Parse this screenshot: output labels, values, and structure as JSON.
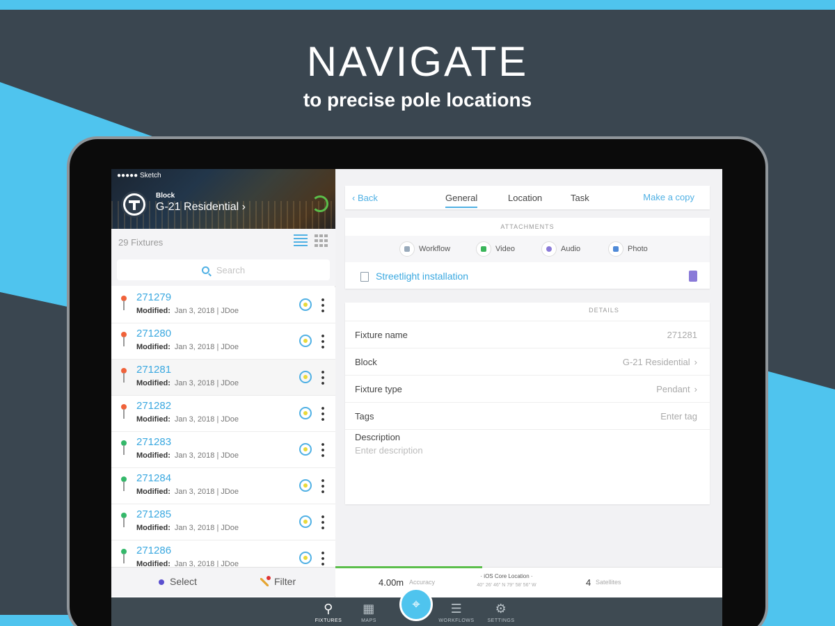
{
  "hero": {
    "title": "NAVIGATE",
    "subtitle": "to precise pole locations"
  },
  "colors": {
    "accent": "#4fb0e4",
    "background": "#3a4650",
    "stripe": "#4fc4ee",
    "pin_orange": "#f0623a",
    "pin_green": "#34b86a"
  },
  "statusbar": {
    "carrier": "●●●●● Sketch"
  },
  "header": {
    "block_label": "Block",
    "block_name": "G-21 Residential ›",
    "sync_icon": "sync-icon"
  },
  "fixtures": {
    "count_label": "29 Fixtures",
    "search_placeholder": "Search"
  },
  "list": [
    {
      "id": "271279",
      "modified_label": "Modified:",
      "modified": "Jan 3, 2018 | JDoe",
      "pin": "orange"
    },
    {
      "id": "271280",
      "modified_label": "Modified:",
      "modified": "Jan 3, 2018 | JDoe",
      "pin": "orange"
    },
    {
      "id": "271281",
      "modified_label": "Modified:",
      "modified": "Jan 3, 2018 | JDoe",
      "pin": "orange"
    },
    {
      "id": "271282",
      "modified_label": "Modified:",
      "modified": "Jan 3, 2018 | JDoe",
      "pin": "orange"
    },
    {
      "id": "271283",
      "modified_label": "Modified:",
      "modified": "Jan 3, 2018 | JDoe",
      "pin": "green"
    },
    {
      "id": "271284",
      "modified_label": "Modified:",
      "modified": "Jan 3, 2018 | JDoe",
      "pin": "green"
    },
    {
      "id": "271285",
      "modified_label": "Modified:",
      "modified": "Jan 3, 2018 | JDoe",
      "pin": "green"
    },
    {
      "id": "271286",
      "modified_label": "Modified:",
      "modified": "Jan 3, 2018 | JDoe",
      "pin": "green"
    }
  ],
  "left_footer": {
    "select": "Select",
    "filter": "Filter"
  },
  "nav": {
    "back": "‹ Back",
    "tabs": [
      "General",
      "Location",
      "Task"
    ],
    "active_tab": "General",
    "copy": "Make a copy"
  },
  "attachments": {
    "heading": "ATTACHMENTS",
    "items": [
      "Workflow",
      "Video",
      "Audio",
      "Photo"
    ],
    "workflow_link": "Streetlight installation"
  },
  "details": {
    "heading": "DETAILS",
    "rows": [
      {
        "label": "Fixture name",
        "value": "271281",
        "chevron": ""
      },
      {
        "label": "Block",
        "value": "G-21 Residential",
        "chevron": "›"
      },
      {
        "label": "Fixture type",
        "value": "Pendant",
        "chevron": "›"
      },
      {
        "label": "Tags",
        "value": "Enter tag",
        "chevron": ""
      }
    ],
    "description_label": "Description",
    "description_placeholder": "Enter description"
  },
  "gps": {
    "accuracy_value": "4.00m",
    "accuracy_label": "Accuracy",
    "location_title": "· iOS Core Location ·",
    "location_coords": "40° 26' 46\" N 79° 58' 56\" W",
    "satellites_value": "4",
    "satellites_label": "Satellites",
    "progress_fraction": 0.38
  },
  "tabbar": {
    "items": [
      {
        "label": "FIXTURES",
        "glyph": "⚲"
      },
      {
        "label": "MAPS",
        "glyph": "▦"
      },
      {
        "label": "WORKFLOWS",
        "glyph": "☰"
      },
      {
        "label": "SETTINGS",
        "glyph": "⚙"
      }
    ],
    "center_glyph": "⌖"
  }
}
